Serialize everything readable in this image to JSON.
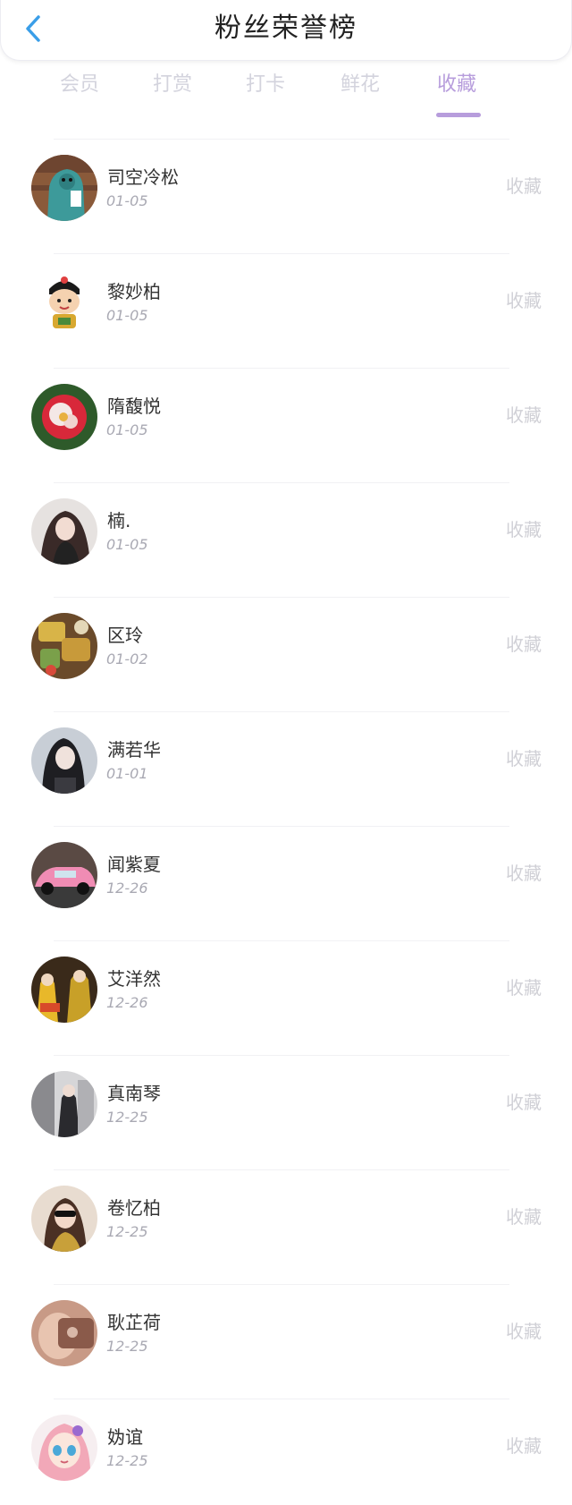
{
  "header": {
    "title": "粉丝荣誉榜",
    "back_icon": "chevron-left-icon",
    "accent": "#3a9ee8"
  },
  "tabs": [
    {
      "label": "会员",
      "active": false
    },
    {
      "label": "打赏",
      "active": false
    },
    {
      "label": "打卡",
      "active": false
    },
    {
      "label": "鲜花",
      "active": false
    },
    {
      "label": "收藏",
      "active": true
    }
  ],
  "colors": {
    "tab_active": "#b79ddc",
    "tab_inactive": "#d3d3dd",
    "action": "#d0d0d6"
  },
  "fans": [
    {
      "name": "司空冷松",
      "date": "01-05",
      "action": "收藏",
      "avatar": "green-hoodie-avatar"
    },
    {
      "name": "黎妙柏",
      "date": "01-05",
      "action": "收藏",
      "avatar": "cartoon-boy-avatar"
    },
    {
      "name": "隋馥悦",
      "date": "01-05",
      "action": "收藏",
      "avatar": "red-flower-avatar"
    },
    {
      "name": "楠.",
      "date": "01-05",
      "action": "收藏",
      "avatar": "girl-portrait-avatar"
    },
    {
      "name": "区玲",
      "date": "01-02",
      "action": "收藏",
      "avatar": "food-photo-avatar"
    },
    {
      "name": "满若华",
      "date": "01-01",
      "action": "收藏",
      "avatar": "girl-dark-hair-avatar"
    },
    {
      "name": "闻紫夏",
      "date": "12-26",
      "action": "收藏",
      "avatar": "pink-car-avatar"
    },
    {
      "name": "艾洋然",
      "date": "12-26",
      "action": "收藏",
      "avatar": "game-characters-avatar"
    },
    {
      "name": "真南琴",
      "date": "12-25",
      "action": "收藏",
      "avatar": "fashion-photo-avatar"
    },
    {
      "name": "卷忆柏",
      "date": "12-25",
      "action": "收藏",
      "avatar": "sunglasses-girl-avatar"
    },
    {
      "name": "耿芷荷",
      "date": "12-25",
      "action": "收藏",
      "avatar": "hand-closeup-avatar"
    },
    {
      "name": "妫谊",
      "date": "12-25",
      "action": "收藏",
      "avatar": "anime-girl-avatar"
    }
  ]
}
